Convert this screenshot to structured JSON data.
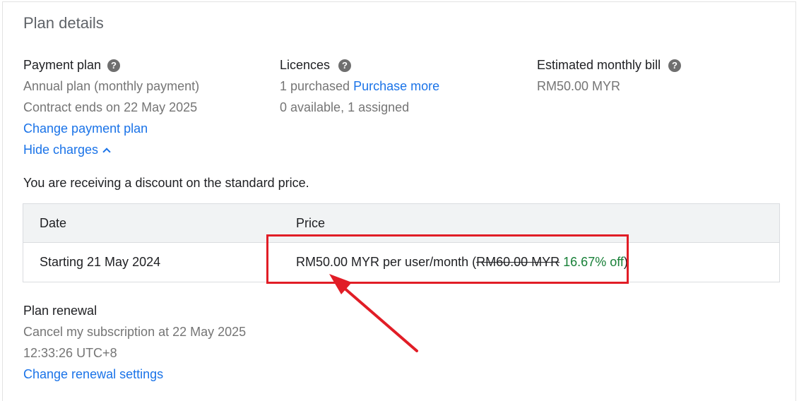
{
  "title": "Plan details",
  "payment_plan": {
    "label": "Payment plan",
    "help_icon": "help-circle-icon",
    "plan_type": "Annual plan (monthly payment)",
    "contract_end": "Contract ends on 22 May 2025",
    "change_link": "Change payment plan",
    "hide_charges_link": "Hide charges"
  },
  "licences": {
    "label": "Licences",
    "purchased": "1 purchased",
    "purchase_more_link": "Purchase more",
    "availability": "0 available, 1 assigned"
  },
  "estimated_bill": {
    "label": "Estimated monthly bill",
    "amount": "RM50.00 MYR"
  },
  "discount_notice": "You are receiving a discount on the standard price.",
  "charges_table": {
    "headers": {
      "date": "Date",
      "price": "Price"
    },
    "rows": [
      {
        "date": "Starting 21 May 2024",
        "price_prefix": "RM50.00 MYR per user/month (",
        "original_price": "RM60.00 MYR",
        "discount": "16.67% off",
        "price_suffix": ")"
      }
    ]
  },
  "plan_renewal": {
    "label": "Plan renewal",
    "cancel_line1": "Cancel my subscription at 22 May 2025",
    "cancel_line2": "12:33:26 UTC+8",
    "change_link": "Change renewal settings"
  },
  "colors": {
    "link": "#1a73e8",
    "discount_green": "#188038",
    "annotation_red": "#e11d26"
  }
}
